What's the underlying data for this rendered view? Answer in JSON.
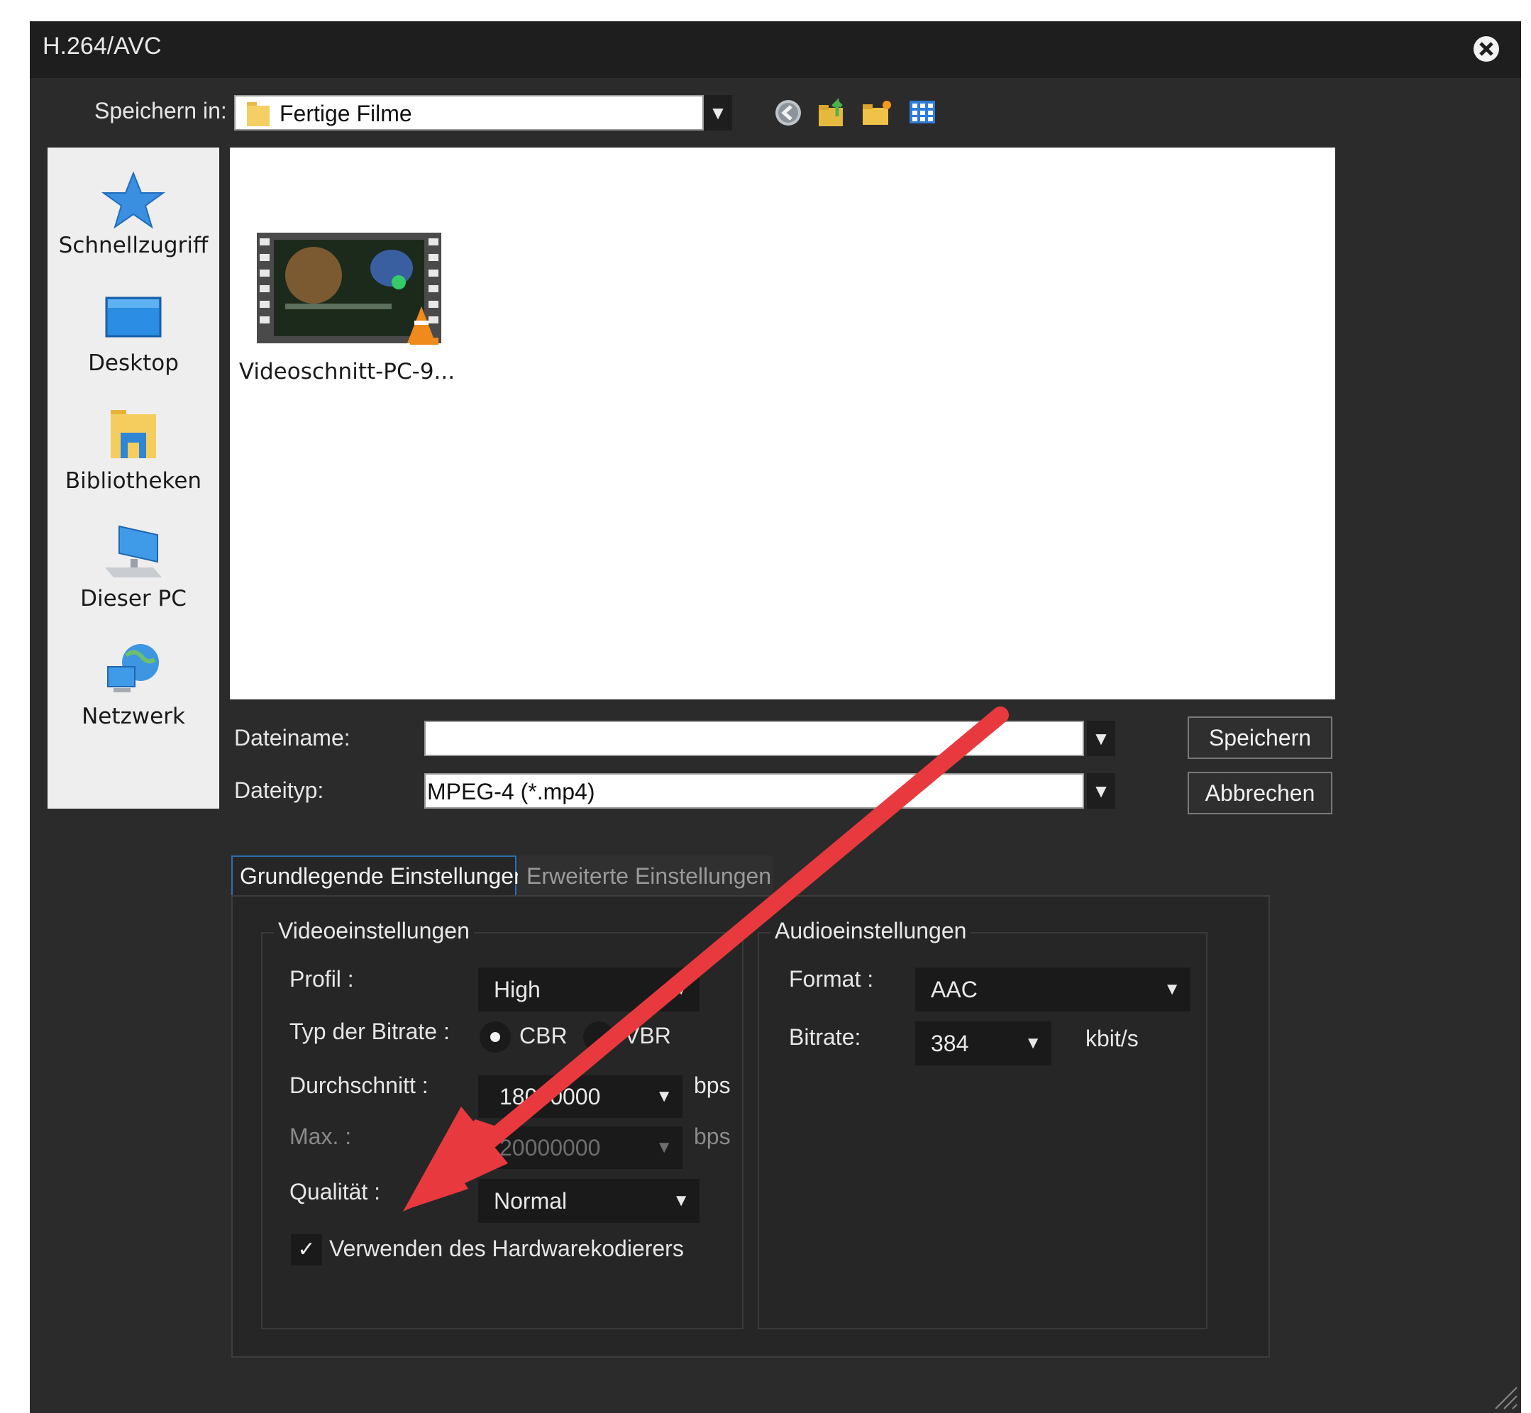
{
  "window": {
    "title": "H.264/AVC"
  },
  "location": {
    "label": "Speichern in:",
    "value": "Fertige Filme"
  },
  "toolbar_icons": [
    "back-icon",
    "up-folder-icon",
    "new-folder-icon",
    "view-menu-icon"
  ],
  "places": [
    {
      "label": "Schnellzugriff",
      "icon": "star-icon"
    },
    {
      "label": "Desktop",
      "icon": "desktop-icon"
    },
    {
      "label": "Bibliotheken",
      "icon": "libraries-icon"
    },
    {
      "label": "Dieser PC",
      "icon": "computer-icon"
    },
    {
      "label": "Netzwerk",
      "icon": "network-icon"
    }
  ],
  "files": [
    {
      "name": "Videoschnitt-PC-9...",
      "icon": "video-file-icon"
    }
  ],
  "filename": {
    "label": "Dateiname:",
    "value": ""
  },
  "filetype": {
    "label": "Dateityp:",
    "value": "MPEG-4 (*.mp4)"
  },
  "buttons": {
    "save": "Speichern",
    "cancel": "Abbrechen"
  },
  "tabs": [
    {
      "label": "Grundlegende Einstellungen",
      "active": true
    },
    {
      "label": "Erweiterte Einstellungen",
      "active": false
    }
  ],
  "video": {
    "title": "Videoeinstellungen",
    "profile_label": "Profil :",
    "profile_value": "High",
    "bitrate_type_label": "Typ der Bitrate :",
    "cbr_label": "CBR",
    "vbr_label": "VBR",
    "bitrate_type_selected": "CBR",
    "avg_label": "Durchschnitt :",
    "avg_value": "18000000",
    "avg_unit": "bps",
    "max_label": "Max. :",
    "max_value": "20000000",
    "max_unit": "bps",
    "quality_label": "Qualität :",
    "quality_value": "Normal",
    "hw_label": "Verwenden des Hardwarekodierers",
    "hw_checked": true
  },
  "audio": {
    "title": "Audioeinstellungen",
    "format_label": "Format :",
    "format_value": "AAC",
    "bitrate_label": "Bitrate:",
    "bitrate_value": "384",
    "bitrate_unit": "kbit/s"
  },
  "colors": {
    "annotation_arrow": "#e8393e",
    "dialog_bg": "#2b2b2b",
    "tab_active_border": "#2f6fb3"
  }
}
